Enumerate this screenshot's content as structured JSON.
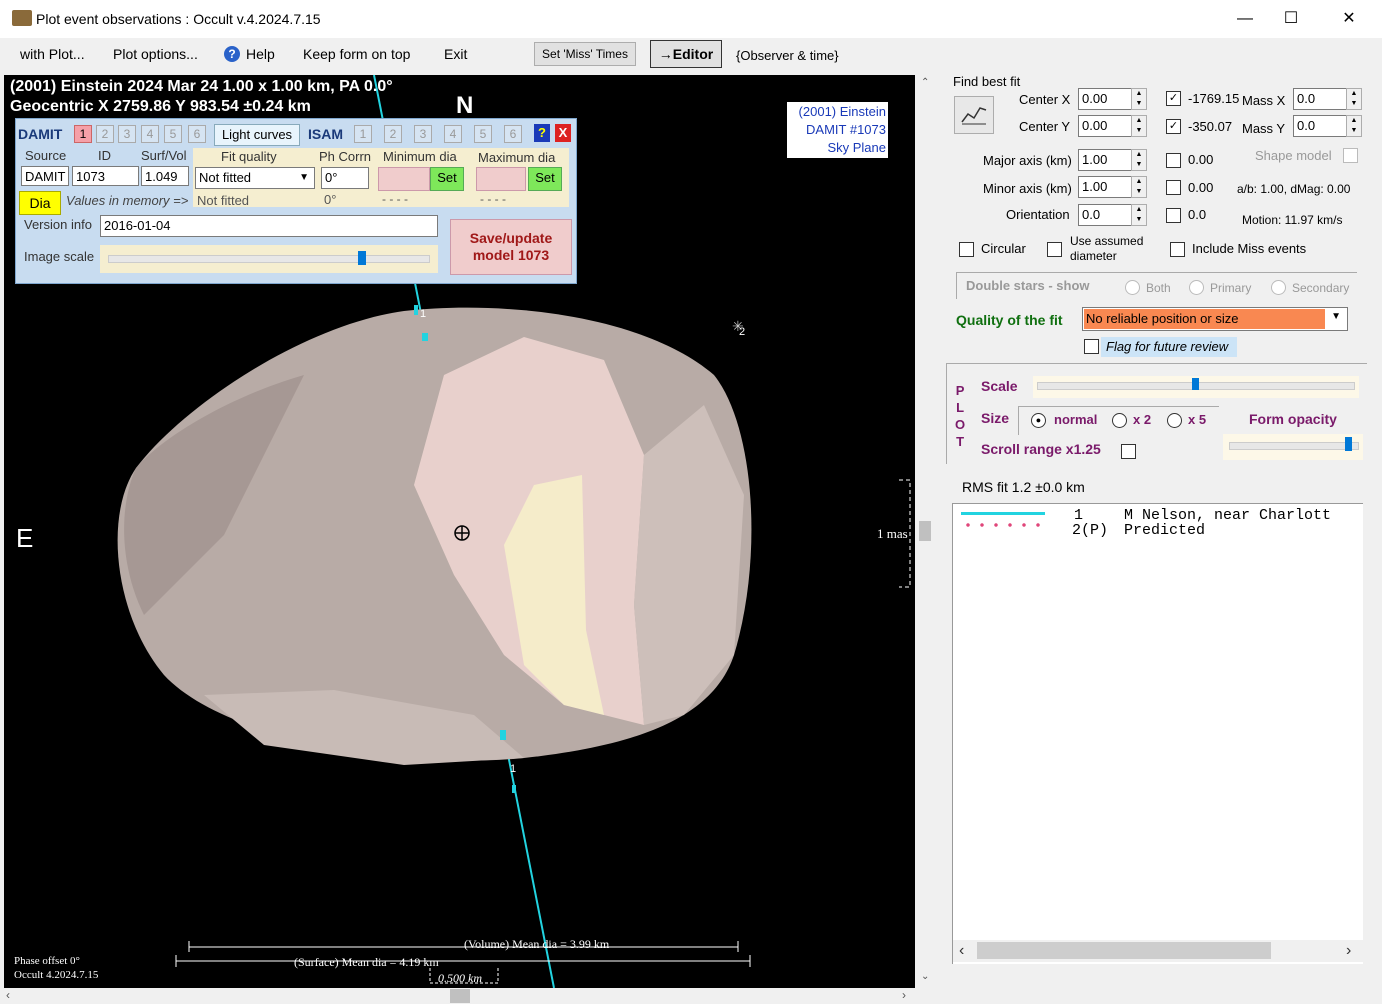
{
  "window": {
    "title": "Plot event observations : Occult v.4.2024.7.15"
  },
  "menu": {
    "with_plot": "with Plot...",
    "plot_options": "Plot options...",
    "help": "Help",
    "keep_on_top": "Keep form on top",
    "exit": "Exit",
    "set_miss_times": "Set 'Miss' Times",
    "editor": "→Editor",
    "observer_time": "{Observer & time}"
  },
  "plot": {
    "header_line1": "(2001) Einstein  2024 Mar 24   1.00 x 1.00 km, PA 0.0°",
    "header_line2": "Geocentric  X  2759.86  Y 983.54 ±0.24 km",
    "north": "N",
    "east": "E",
    "legend_box": [
      "(2001) Einstein",
      "DAMIT #1073",
      "Sky Plane"
    ],
    "star_label": "2",
    "chord_label_top": "1",
    "chord_label_bottom": "1",
    "mas_label": "1 mas",
    "volume_dia": "(Volume) Mean dia = 3.99 km",
    "surface_dia": "(Surface) Mean dia = 4.19 km",
    "scale_km": "0.500 km",
    "phase_offset": "Phase offset 0°",
    "occult_version": "Occult 4.2024.7.15",
    "colors": {
      "shape": "#b8aba6",
      "highlight": "#e8d0cc",
      "chord": "#22d3e0"
    }
  },
  "damit": {
    "title": "DAMIT",
    "tabs": [
      "1",
      "2",
      "3",
      "4",
      "5",
      "6"
    ],
    "light_curves": "Light curves",
    "isam": "ISAM",
    "isam_tabs": [
      "1",
      "2",
      "3",
      "4",
      "5",
      "6"
    ],
    "help_q": "?",
    "close_x": "X",
    "source_label": "Source",
    "id_label": "ID",
    "surfvol_label": "Surf/Vol",
    "source_value": "DAMIT",
    "id_value": "1073",
    "surfvol_value": "1.049",
    "dia_button": "Dia",
    "values_in_memory": "Values in memory =>",
    "fit_quality_label": "Fit quality",
    "fit_quality_value": "Not fitted",
    "fit_quality_memory": "Not fitted",
    "ph_corrn_label": "Ph Corrn",
    "ph_corrn_value": "0°",
    "ph_corrn_memory": "0°",
    "min_dia_label": "Minimum dia",
    "max_dia_label": "Maximum dia",
    "set1": "Set",
    "set2": "Set",
    "min_dia_memory": "- - - -",
    "max_dia_memory": "- - - -",
    "version_label": "Version info",
    "version_value": "2016-01-04",
    "image_scale_label": "Image scale",
    "image_scale_level": 0.8,
    "save_button": "Save/update model  1073"
  },
  "fit": {
    "find_best_fit": "Find best fit",
    "center_x_label": "Center X",
    "center_x": "0.00",
    "center_y_label": "Center Y",
    "center_y": "0.00",
    "cx_result": "-1769.15",
    "cy_result": "-350.07",
    "mass_x_label": "Mass X",
    "mass_x": "0.0",
    "mass_y_label": "Mass Y",
    "mass_y": "0.0",
    "major_label": "Major axis (km)",
    "major": "1.00",
    "major_result": "0.00",
    "minor_label": "Minor axis (km)",
    "minor": "1.00",
    "minor_result": "0.00",
    "orient_label": "Orientation",
    "orient": "0.0",
    "orient_result": "0.0",
    "shape_model": "Shape model",
    "ab_dmag": "a/b: 1.00, dMag: 0.00",
    "motion": "Motion: 11.97 km/s",
    "circular": "Circular",
    "use_assumed": "Use assumed diameter",
    "include_miss": "Include Miss events",
    "double_stars": "Double stars - show",
    "both": "Both",
    "primary": "Primary",
    "secondary": "Secondary",
    "quality_label": "Quality of the fit",
    "quality_value": "No reliable position or size",
    "flag_review": "Flag for future review"
  },
  "plot_opts": {
    "plot_letters": [
      "P",
      "L",
      "O",
      "T"
    ],
    "scale": "Scale",
    "scale_level": 0.5,
    "size": "Size",
    "normal": "normal",
    "x2": "x 2",
    "x5": "x 5",
    "form_opacity": "Form opacity",
    "opacity_level": 0.95,
    "scroll_range": "Scroll range x1.25"
  },
  "rms": "RMS fit  1.2 ±0.0 km",
  "observers": [
    {
      "num": "1",
      "name": "M Nelson, near Charlott"
    },
    {
      "num": "2(P)",
      "name": "Predicted"
    }
  ]
}
